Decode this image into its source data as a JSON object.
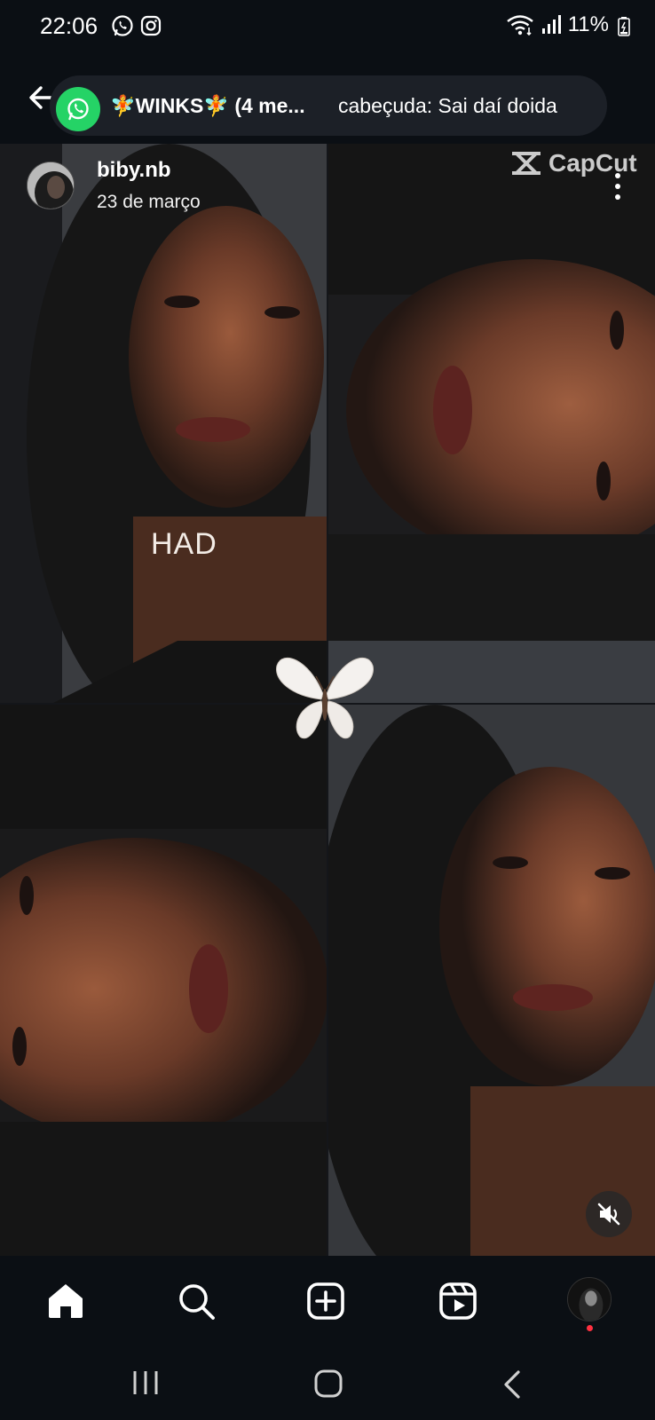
{
  "status_bar": {
    "time": "22:06",
    "battery": "11%",
    "icons": [
      "whatsapp-icon",
      "instagram-icon",
      "wifi-icon",
      "signal-icon",
      "battery-icon"
    ]
  },
  "notification": {
    "app": "WhatsApp",
    "title": "🧚WINKS🧚 (4 me...",
    "message": "cabeçuda: Sai daí doida",
    "accent_color": "#25d366"
  },
  "post": {
    "username": "biby.nb",
    "date": "23 de março",
    "overlay_text": "HAD",
    "watermark": "CapCut"
  },
  "bottom_nav": {
    "items": [
      "home-icon",
      "search-icon",
      "create-icon",
      "reels-icon",
      "profile-avatar"
    ],
    "notification_dot_color": "#ff3040"
  },
  "system_nav": {
    "items": [
      "recents-button",
      "home-button",
      "back-button"
    ]
  }
}
